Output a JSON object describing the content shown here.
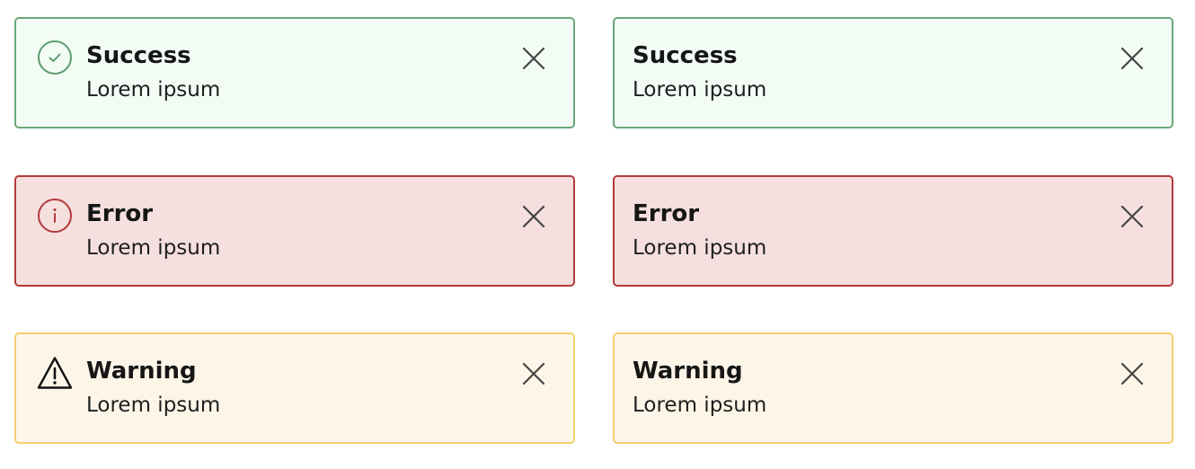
{
  "alerts": [
    {
      "variant": "success",
      "title": "Success",
      "message": "Lorem ipsum",
      "icon": "check-circle-icon",
      "show_icon": true,
      "border_color": "#6aa77a",
      "background": "#f2fcf5"
    },
    {
      "variant": "success",
      "title": "Success",
      "message": "Lorem ipsum",
      "icon": null,
      "show_icon": false,
      "border_color": "#6aa77a",
      "background": "#f2fcf5"
    },
    {
      "variant": "error",
      "title": "Error",
      "message": "Lorem ipsum",
      "icon": "info-circle-icon",
      "show_icon": true,
      "border_color": "#b23a3a",
      "background": "#f5dfdf"
    },
    {
      "variant": "error",
      "title": "Error",
      "message": "Lorem ipsum",
      "icon": null,
      "show_icon": false,
      "border_color": "#b23a3a",
      "background": "#f5dfdf"
    },
    {
      "variant": "warning",
      "title": "Warning",
      "message": "Lorem ipsum",
      "icon": "warning-triangle-icon",
      "show_icon": true,
      "border_color": "#f2cf70",
      "background": "#fdf6e8"
    },
    {
      "variant": "warning",
      "title": "Warning",
      "message": "Lorem ipsum",
      "icon": null,
      "show_icon": false,
      "border_color": "#f2cf70",
      "background": "#fdf6e8"
    }
  ],
  "close_icon": "close-icon",
  "icon_colors": {
    "success": "#5f9b6f",
    "error": "#b23a3a",
    "warning": "#111111",
    "close": "#444444"
  }
}
